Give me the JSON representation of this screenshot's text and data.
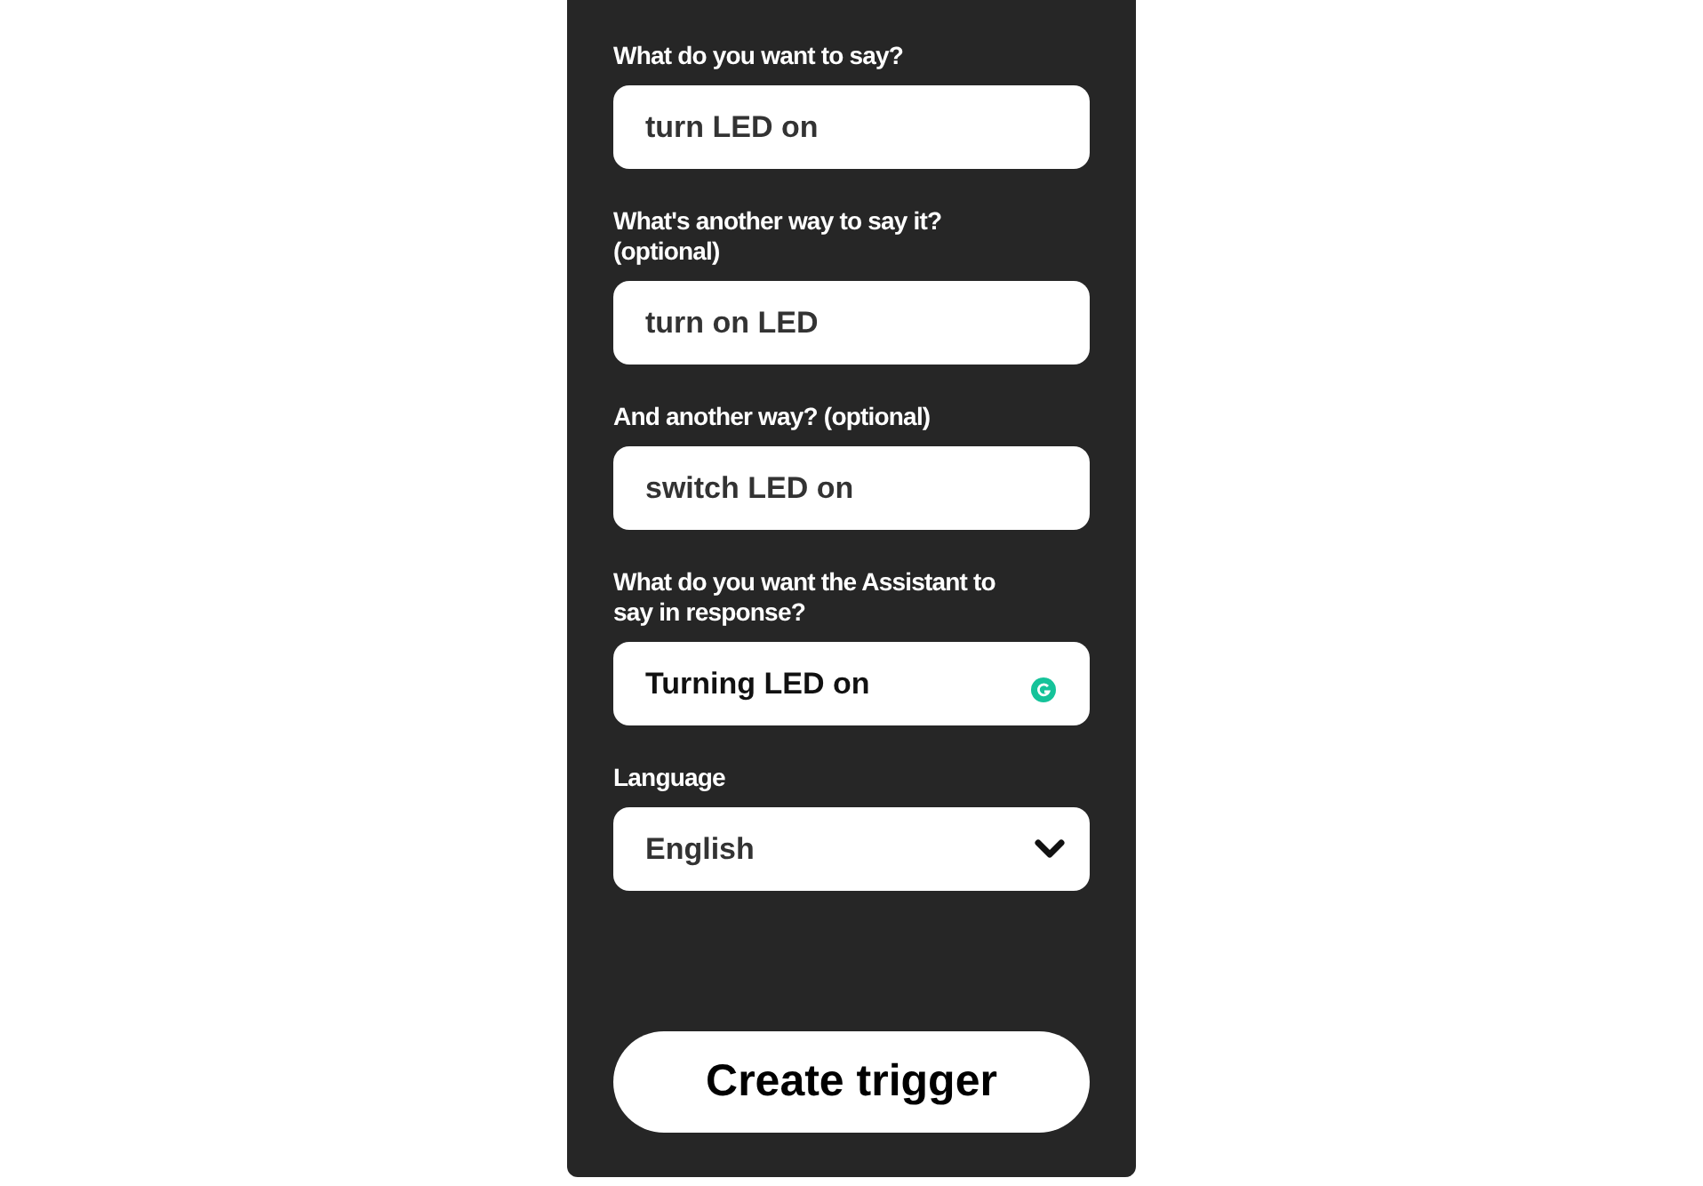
{
  "fields": [
    {
      "kind": "text",
      "label": "What do you want to say?",
      "value": "turn LED on",
      "assist_icon": false
    },
    {
      "kind": "text",
      "label": "What's another way to say it? (optional)",
      "value": "turn on LED",
      "assist_icon": false
    },
    {
      "kind": "text",
      "label": "And another way? (optional)",
      "value": "switch LED on",
      "assist_icon": false
    },
    {
      "kind": "text",
      "label": "What do you want the Assistant to say in response?",
      "value": "Turning LED on",
      "assist_icon": true
    },
    {
      "kind": "select",
      "label": "Language",
      "value": "English",
      "assist_icon": false
    }
  ],
  "button": "Create trigger"
}
